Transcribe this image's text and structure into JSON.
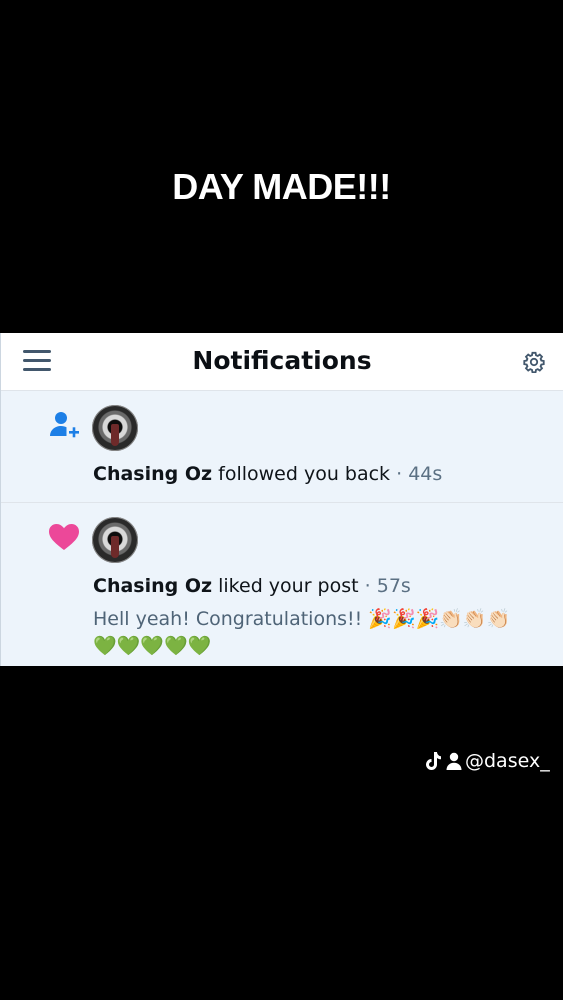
{
  "caption": "DAY MADE!!!",
  "topbar": {
    "title": "Notifications",
    "menu_icon": "hamburger-menu-icon",
    "settings_icon": "gear-icon"
  },
  "notifications": [
    {
      "type_icon": "person-add-icon",
      "user": "Chasing Oz",
      "action": "followed you back",
      "separator": "·",
      "time": "44s"
    },
    {
      "type_icon": "heart-icon",
      "user": "Chasing Oz",
      "action": "liked your post",
      "separator": "·",
      "time": "57s",
      "post_text": "Hell yeah! Congratulations!!",
      "post_emojis": "🎉🎉🎉👏🏻👏🏻👏🏻💚💚💚💚💚"
    }
  ],
  "watermark": {
    "handle": "@dasex_"
  },
  "colors": {
    "accent_blue": "#1d7fe6",
    "heart_pink": "#ec4899",
    "panel_bg": "#edf4fb"
  }
}
